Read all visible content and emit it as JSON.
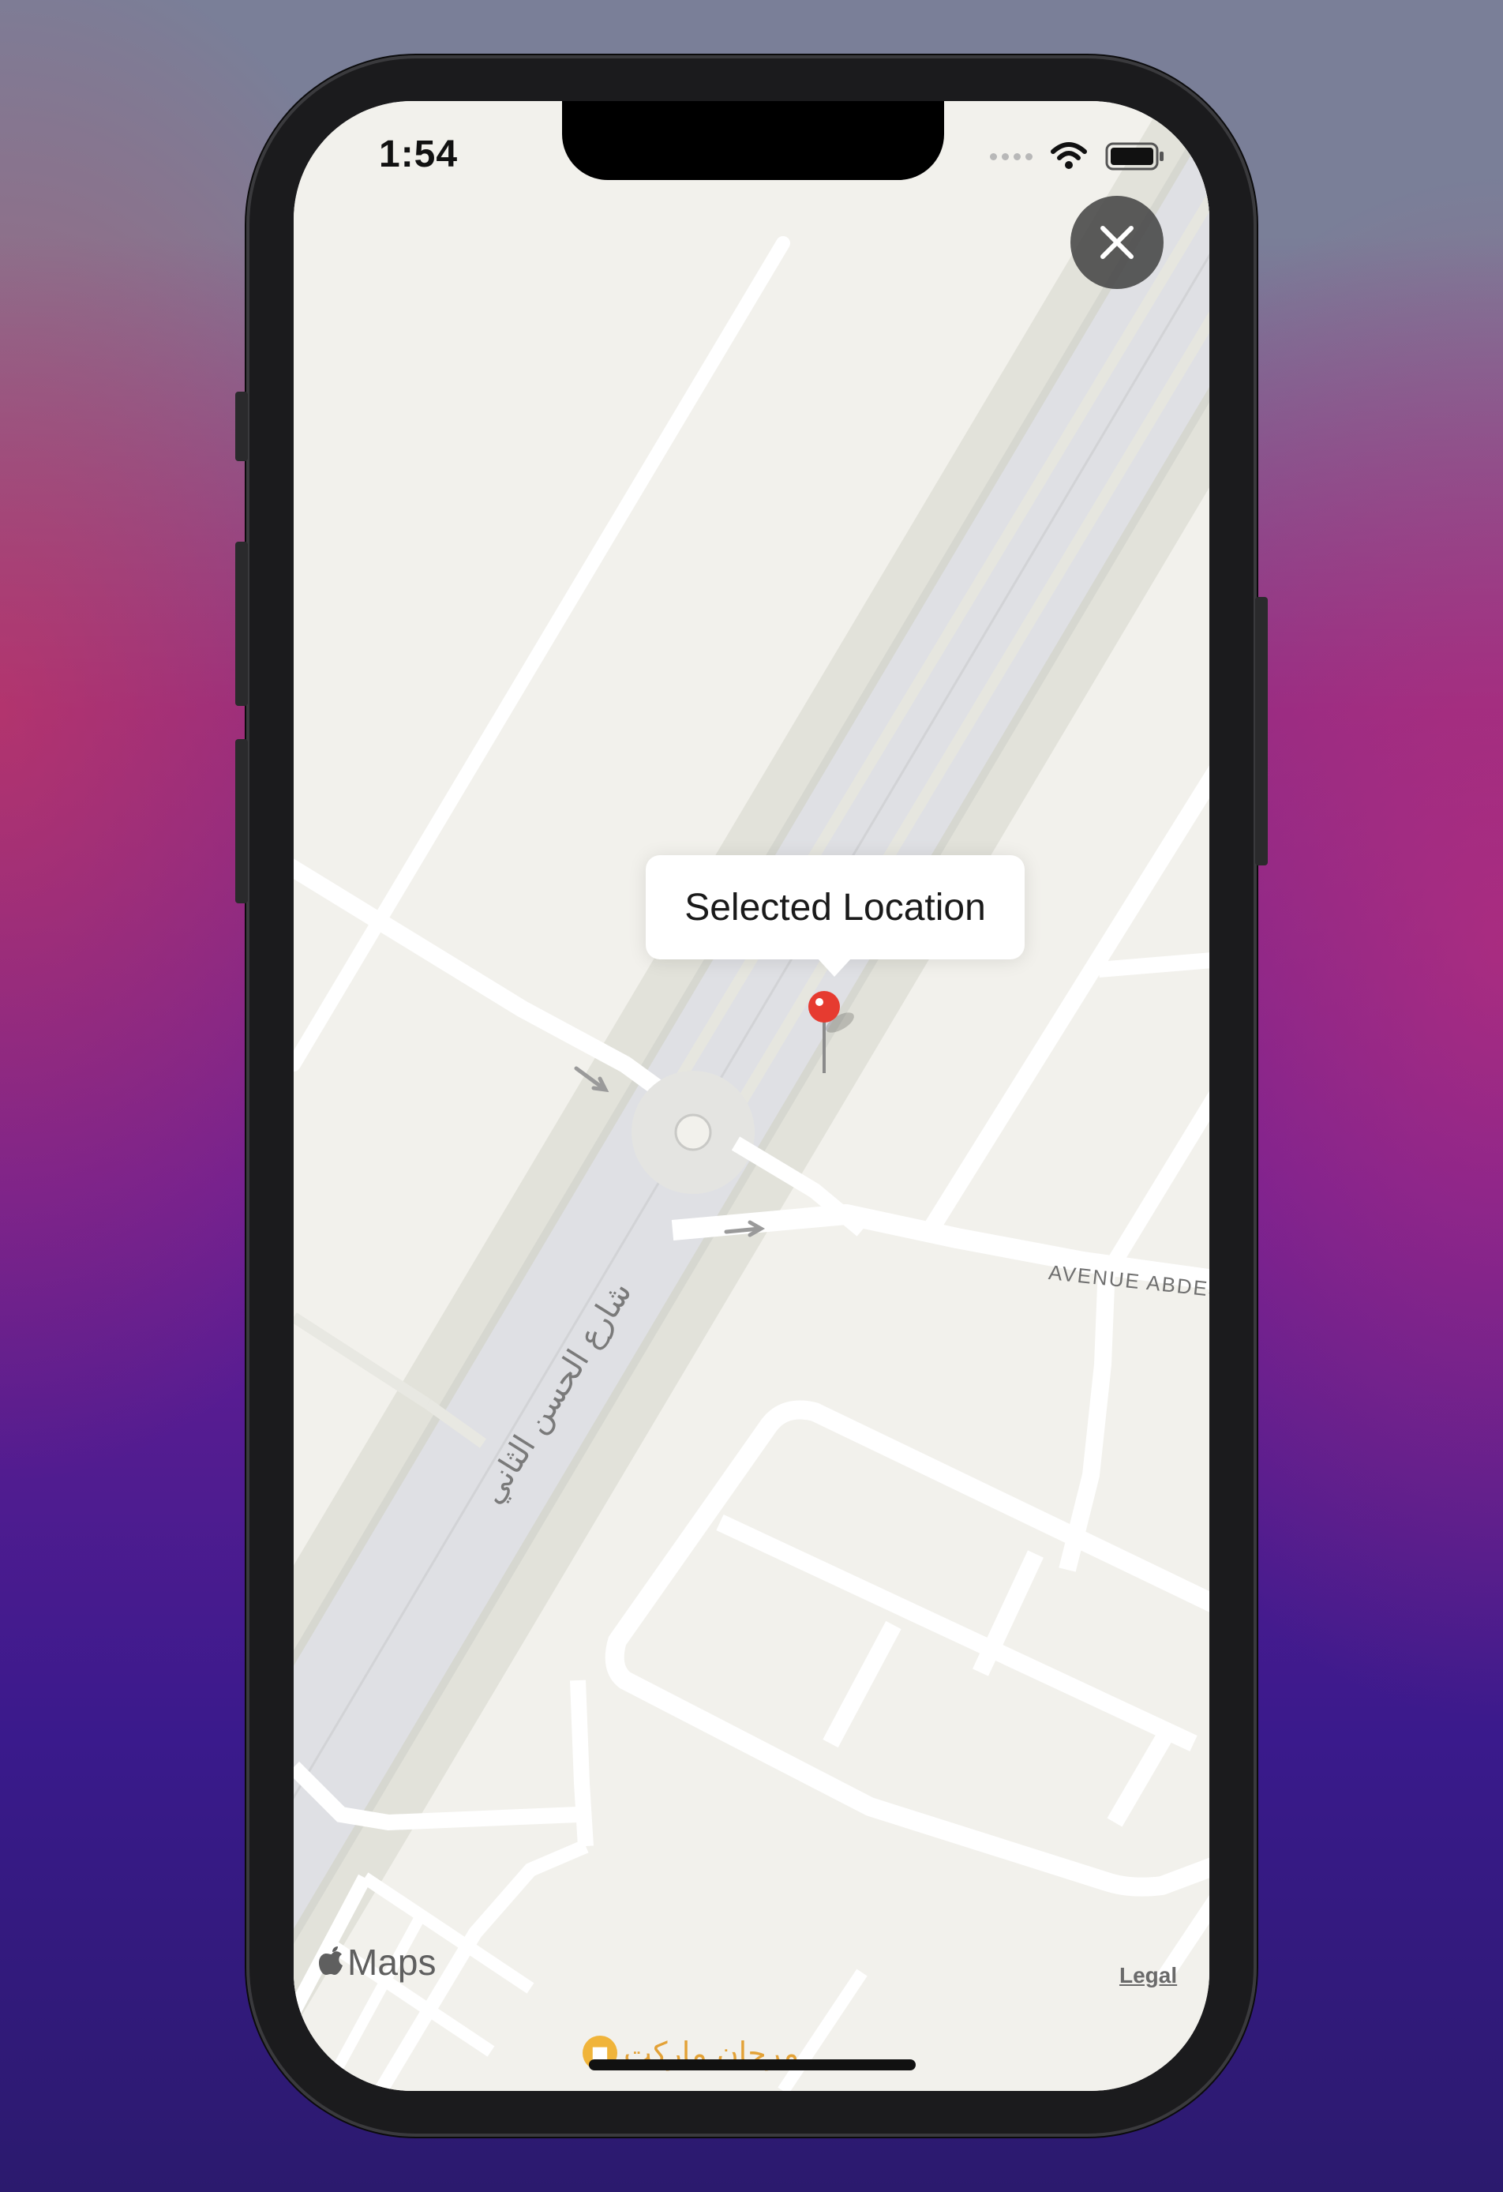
{
  "status_bar": {
    "time": "1:54"
  },
  "map": {
    "callout_title": "Selected Location",
    "street_label_latin": "AVENUE ABDES",
    "street_label_arabic": "شارع الحسن الثاني",
    "poi_label": "مرجان ماركت",
    "attribution": {
      "brand": "Maps",
      "legal": "Legal"
    }
  },
  "icons": {
    "close": "close-icon",
    "pin": "map-pin-icon",
    "wifi": "wifi-icon",
    "battery": "battery-icon",
    "signal": "cellular-signal-icon",
    "apple": "apple-logo-icon",
    "poi": "shopping-bag-icon"
  },
  "colors": {
    "map_background": "#f2f1ec",
    "highway": "#dfe0e4",
    "road": "#ffffff",
    "pin": "#e63b30",
    "close_button": "#464646",
    "poi": "#e3a237"
  }
}
